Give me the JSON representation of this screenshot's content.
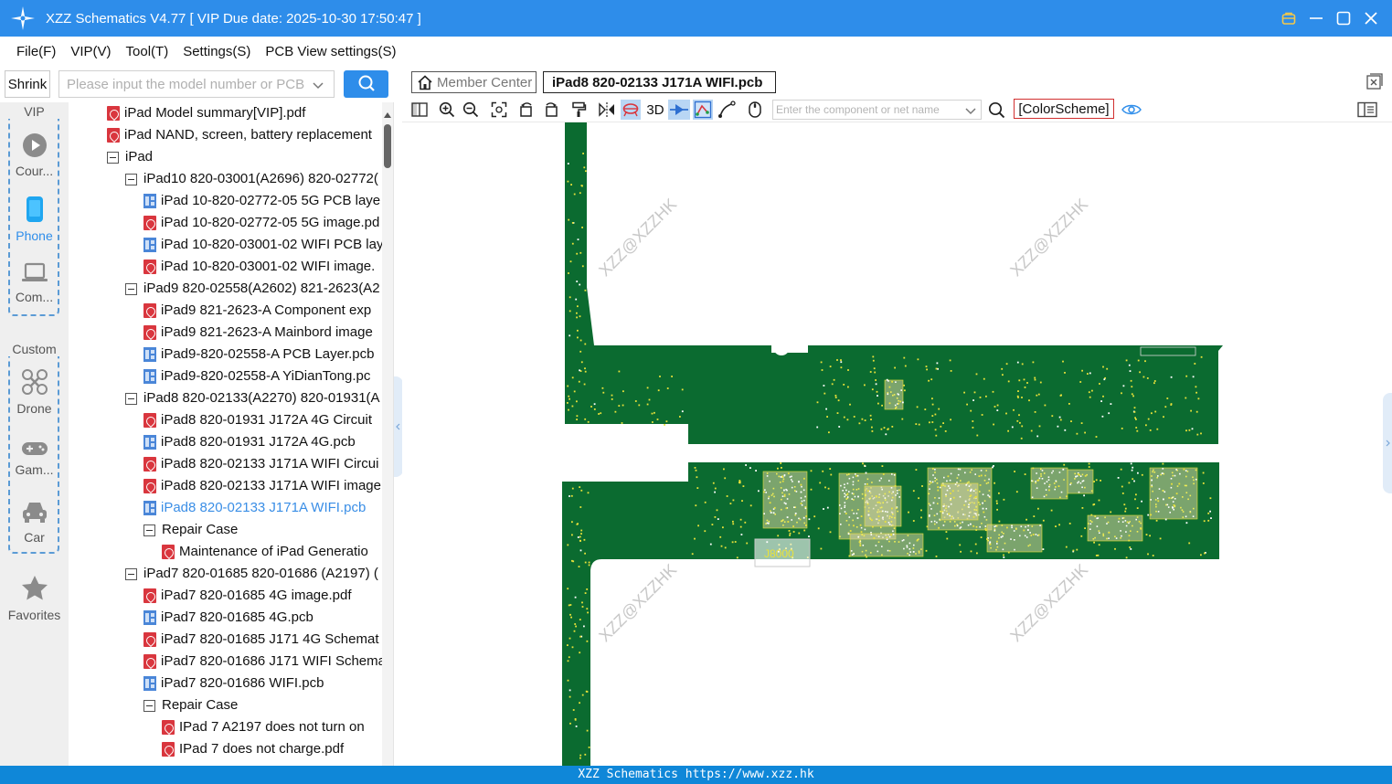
{
  "window": {
    "title": "XZZ Schematics V4.77 [ VIP Due date: 2025-10-30 17:50:47 ]"
  },
  "menu": [
    "File(F)",
    "VIP(V)",
    "Tool(T)",
    "Settings(S)",
    "PCB View settings(S)"
  ],
  "search": {
    "shrink_label": "Shrink",
    "placeholder": "Please input the model number or PCB"
  },
  "rail": {
    "vip_title": "VIP",
    "vip_items": [
      {
        "label": "Cour...",
        "icon": "play-icon"
      },
      {
        "label": "Phone",
        "icon": "phone-icon"
      },
      {
        "label": "Com...",
        "icon": "laptop-icon"
      }
    ],
    "custom_title": "Custom",
    "custom_items": [
      {
        "label": "Drone",
        "icon": "drone-icon"
      },
      {
        "label": "Gam...",
        "icon": "gamepad-icon"
      },
      {
        "label": "Car",
        "icon": "car-icon"
      }
    ],
    "favorites_label": "Favorites"
  },
  "tree": [
    {
      "type": "pdf",
      "indent": 0,
      "label": "iPad Model summary[VIP].pdf"
    },
    {
      "type": "pdf",
      "indent": 0,
      "label": "iPad NAND, screen, battery replacement"
    },
    {
      "type": "folder",
      "indent": 0,
      "label": "iPad"
    },
    {
      "type": "folder",
      "indent": 1,
      "label": "iPad10 820-03001(A2696) 820-02772("
    },
    {
      "type": "pcb",
      "indent": 2,
      "label": "iPad 10-820-02772-05 5G PCB laye"
    },
    {
      "type": "pdf",
      "indent": 2,
      "label": "iPad 10-820-02772-05 5G image.pd"
    },
    {
      "type": "pcb",
      "indent": 2,
      "label": "iPad 10-820-03001-02 WIFI PCB lay"
    },
    {
      "type": "pdf",
      "indent": 2,
      "label": "iPad 10-820-03001-02 WIFI image."
    },
    {
      "type": "folder",
      "indent": 1,
      "label": "iPad9 820-02558(A2602) 821-2623(A2"
    },
    {
      "type": "pdf",
      "indent": 2,
      "label": "iPad9 821-2623-A Component exp"
    },
    {
      "type": "pdf",
      "indent": 2,
      "label": "iPad9 821-2623-A Mainbord image"
    },
    {
      "type": "pcb",
      "indent": 2,
      "label": "iPad9-820-02558-A PCB Layer.pcb"
    },
    {
      "type": "pcb",
      "indent": 2,
      "label": "iPad9-820-02558-A YiDianTong.pc"
    },
    {
      "type": "folder",
      "indent": 1,
      "label": "iPad8 820-02133(A2270) 820-01931(A"
    },
    {
      "type": "pdf",
      "indent": 2,
      "label": "iPad8 820-01931 J172A 4G Circuit"
    },
    {
      "type": "pcb",
      "indent": 2,
      "label": "iPad8 820-01931 J172A 4G.pcb"
    },
    {
      "type": "pdf",
      "indent": 2,
      "label": "iPad8 820-02133 J171A WIFI Circui"
    },
    {
      "type": "pdf",
      "indent": 2,
      "label": "iPad8 820-02133 J171A WIFI image"
    },
    {
      "type": "pcb",
      "indent": 2,
      "label": "iPad8 820-02133 J171A WIFI.pcb",
      "selected": true
    },
    {
      "type": "folder",
      "indent": 2,
      "label": "Repair Case"
    },
    {
      "type": "pdf",
      "indent": 3,
      "label": "Maintenance of iPad Generatio"
    },
    {
      "type": "folder",
      "indent": 1,
      "label": "iPad7 820-01685 820-01686 (A2197) ("
    },
    {
      "type": "pdf",
      "indent": 2,
      "label": "iPad7 820-01685 4G image.pdf"
    },
    {
      "type": "pcb",
      "indent": 2,
      "label": "iPad7 820-01685 4G.pcb"
    },
    {
      "type": "pdf",
      "indent": 2,
      "label": "iPad7 820-01685 J171 4G Schemat"
    },
    {
      "type": "pdf",
      "indent": 2,
      "label": "iPad7 820-01686 J171 WIFI Schema"
    },
    {
      "type": "pcb",
      "indent": 2,
      "label": "iPad7 820-01686 WIFI.pcb"
    },
    {
      "type": "folder",
      "indent": 2,
      "label": "Repair Case"
    },
    {
      "type": "pdf",
      "indent": 3,
      "label": "IPad 7 A2197 does not turn on"
    },
    {
      "type": "pdf",
      "indent": 3,
      "label": "IPad 7 does not charge.pdf"
    }
  ],
  "tabs": {
    "member_center": "Member Center",
    "active_file": "iPad8 820-02133 J171A WIFI.pcb"
  },
  "toolbar": {
    "label_3d": "3D",
    "component_placeholder": "Enter the component or net name",
    "colorscheme_label": "[ColorScheme]"
  },
  "board": {
    "watermark": "XZZ@XZZHK",
    "component_label": "J8000"
  },
  "colors": {
    "accent": "#2e8dea",
    "board_green": "#0b6b30",
    "pad_yellow": "#e9e23a",
    "selected_text": "#3a8ee6",
    "statusbar": "#0f87d8"
  },
  "status": "XZZ Schematics https://www.xzz.hk"
}
